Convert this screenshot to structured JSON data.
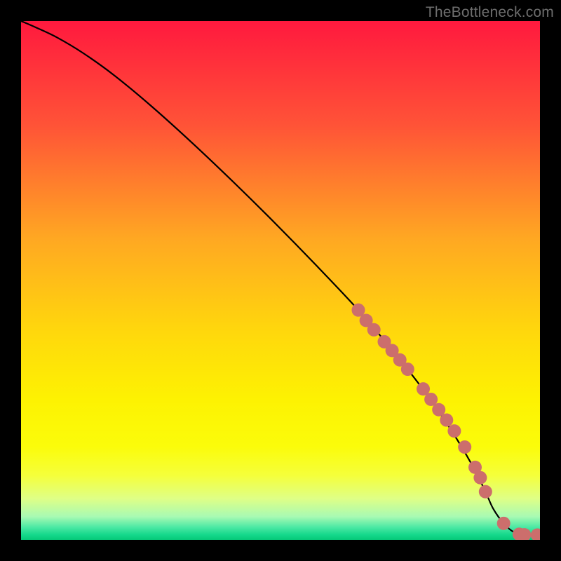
{
  "watermark": "TheBottleneck.com",
  "gradient": {
    "stops": [
      {
        "offset": 0.0,
        "color": "#ff193e"
      },
      {
        "offset": 0.2,
        "color": "#ff5337"
      },
      {
        "offset": 0.42,
        "color": "#ffa822"
      },
      {
        "offset": 0.6,
        "color": "#ffd80c"
      },
      {
        "offset": 0.73,
        "color": "#fdf202"
      },
      {
        "offset": 0.82,
        "color": "#fbfc0a"
      },
      {
        "offset": 0.875,
        "color": "#f5ff3a"
      },
      {
        "offset": 0.92,
        "color": "#dfff86"
      },
      {
        "offset": 0.955,
        "color": "#a8fab3"
      },
      {
        "offset": 0.975,
        "color": "#4de9a4"
      },
      {
        "offset": 0.99,
        "color": "#15d88b"
      },
      {
        "offset": 1.0,
        "color": "#06c878"
      }
    ]
  },
  "marker_color": "#cc6e6c",
  "line_color": "#000000",
  "chart_data": {
    "type": "line",
    "title": "",
    "xlabel": "",
    "ylabel": "",
    "xlim": [
      0,
      100
    ],
    "ylim": [
      0,
      100
    ],
    "series": [
      {
        "name": "bottleneck-curve",
        "x": [
          0,
          3,
          7,
          12,
          18,
          25,
          33,
          41,
          49,
          57,
          65,
          72,
          78,
          83,
          87,
          89.5,
          91,
          93,
          95,
          97.5,
          99.5
        ],
        "y": [
          100,
          98.7,
          96.8,
          93.8,
          89.5,
          83.7,
          76.5,
          68.9,
          61.0,
          52.8,
          44.3,
          36.0,
          28.3,
          21.0,
          14.3,
          9.3,
          6.0,
          3.2,
          1.5,
          0.95,
          0.95
        ]
      }
    ],
    "markers": {
      "name": "highlighted-points",
      "x": [
        65.0,
        66.5,
        68.0,
        70.0,
        71.5,
        73.0,
        74.5,
        77.5,
        79.0,
        80.5,
        82.0,
        83.5,
        85.5,
        87.5,
        88.5,
        89.5,
        93.0,
        96.0,
        97.0,
        99.5
      ],
      "y": [
        44.3,
        42.3,
        40.5,
        38.2,
        36.5,
        34.7,
        32.9,
        29.1,
        27.1,
        25.1,
        23.1,
        21.0,
        17.9,
        14.0,
        12.0,
        9.3,
        3.2,
        1.1,
        1.0,
        0.95
      ]
    }
  }
}
